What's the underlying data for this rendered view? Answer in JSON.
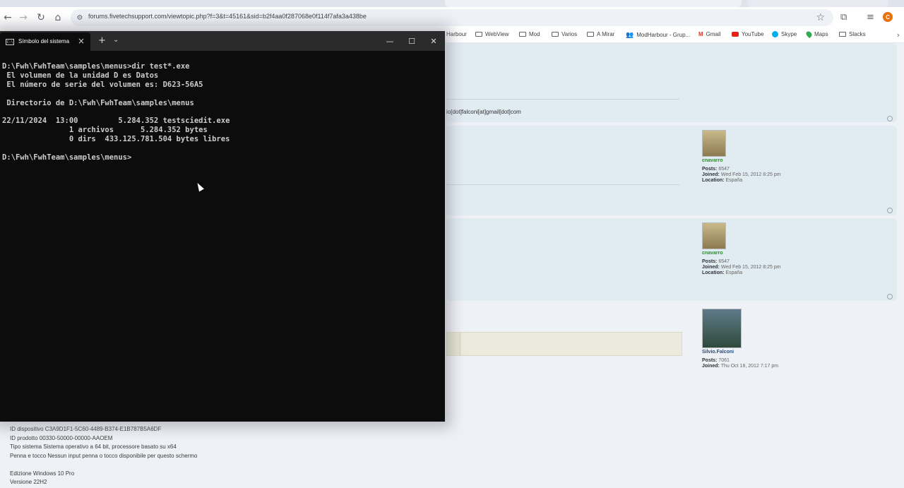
{
  "browser": {
    "url": "forums.fivetechsupport.com/viewtopic.php?f=3&t=45161&sid=b2f4aa0f287068e0f114f7afa3a438be",
    "profile_initial": "C",
    "bookmarks": [
      {
        "label": "Harbour",
        "icon": "folder-icon"
      },
      {
        "label": "WebView",
        "icon": "folder-icon"
      },
      {
        "label": "Mod",
        "icon": "folder-icon"
      },
      {
        "label": "Varios",
        "icon": "folder-icon"
      },
      {
        "label": "A Mirar",
        "icon": "folder-icon"
      },
      {
        "label": "ModHarbour - Grup...",
        "icon": "group-icon"
      },
      {
        "label": "Gmail",
        "icon": "gmail-icon"
      },
      {
        "label": "YouTube",
        "icon": "youtube-icon"
      },
      {
        "label": "Skype",
        "icon": "skype-icon"
      },
      {
        "label": "Maps",
        "icon": "maps-icon"
      },
      {
        "label": "Slacks",
        "icon": "folder-icon"
      }
    ]
  },
  "forum": {
    "email_text": "io[dot]falconi[at]gmail[dot]com",
    "posts": [
      {
        "username": "cnavarro",
        "posts_label": "Posts:",
        "posts": "6547",
        "joined_label": "Joined:",
        "joined": "Wed Feb 15, 2012 8:25 pm",
        "location_label": "Location:",
        "location": "España",
        "name_color": "#2e8b2e"
      },
      {
        "username": "cnavarro",
        "posts_label": "Posts:",
        "posts": "6547",
        "joined_label": "Joined:",
        "joined": "Wed Feb 15, 2012 8:25 pm",
        "location_label": "Location:",
        "location": "España",
        "name_color": "#2e8b2e"
      },
      {
        "username": "Silvio.Falconi",
        "posts_label": "Posts:",
        "posts": "7061",
        "joined_label": "Joined:",
        "joined": "Thu Oct 18, 2012 7:17 pm",
        "name_color": "#1b4f8a"
      }
    ],
    "system_info": [
      "ID dispositivo C3A9D1F1-5C60-4489-B374-E1B787B5A6DF",
      "ID prodotto 00330-50000-00000-AAOEM",
      "Tipo sistema Sistema operativo a 64 bit, processore basato su x64",
      "Penna e tocco Nessun input penna o tocco disponibile per questo schermo",
      "",
      "Edizione Windows 10 Pro",
      "Versione 22H2"
    ]
  },
  "terminal": {
    "tab_title": "Símbolo del sistema",
    "lines": [
      "D:\\Fwh\\FwhTeam\\samples\\menus>dir test*.exe",
      " El volumen de la unidad D es Datos",
      " El número de serie del volumen es: D623-56A5",
      "",
      " Directorio de D:\\Fwh\\FwhTeam\\samples\\menus",
      "",
      "22/11/2024  13:00         5.284.352 testsciedit.exe",
      "               1 archivos      5.284.352 bytes",
      "               0 dirs  433.125.781.504 bytes libres",
      "",
      "D:\\Fwh\\FwhTeam\\samples\\menus>"
    ]
  }
}
